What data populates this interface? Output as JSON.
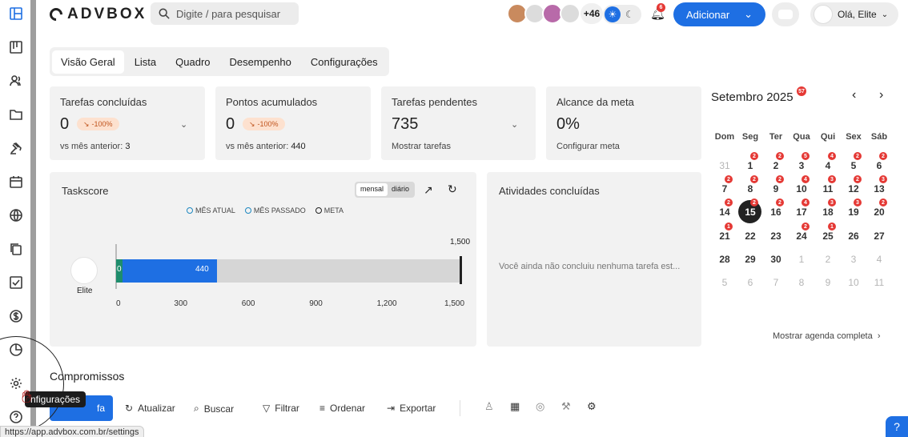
{
  "header": {
    "logo_text": "ADVBOX",
    "search_placeholder": "Digite / para pesquisar",
    "avatars_more": "+46",
    "notifications_count": "6",
    "add_label": "Adicionar",
    "user_greeting": "Olá, Elite"
  },
  "tabs": [
    "Visão Geral",
    "Lista",
    "Quadro",
    "Desempenho",
    "Configurações"
  ],
  "cards": [
    {
      "title": "Tarefas concluídas",
      "value": "0",
      "pill": "-100%",
      "foot_label": "vs mês anterior:",
      "foot_value": "3"
    },
    {
      "title": "Pontos acumulados",
      "value": "0",
      "pill": "-100%",
      "foot_label": "vs mês anterior:",
      "foot_value": "440"
    },
    {
      "title": "Tarefas pendentes",
      "value": "735",
      "foot_label": "Mostrar tarefas"
    },
    {
      "title": "Alcance da meta",
      "value": "0%",
      "foot_label": "Configurar meta"
    }
  ],
  "taskscore": {
    "title": "Taskscore",
    "toggle": [
      "mensal",
      "diário"
    ],
    "legend": [
      "MÊS ATUAL",
      "MÊS PASSADO",
      "META"
    ],
    "user_label": "Elite",
    "goal_label": "1,500",
    "current_label": "0",
    "previous_label": "440",
    "ticks": [
      "0",
      "300",
      "600",
      "900",
      "1,200",
      "1,500"
    ]
  },
  "chart_data": {
    "type": "bar",
    "categories": [
      "Elite"
    ],
    "series": [
      {
        "name": "MÊS ATUAL",
        "values": [
          0
        ]
      },
      {
        "name": "MÊS PASSADO",
        "values": [
          440
        ]
      },
      {
        "name": "META",
        "values": [
          1500
        ]
      }
    ],
    "xlim": [
      0,
      1500
    ],
    "xticks": [
      0,
      300,
      600,
      900,
      1200,
      1500
    ],
    "colors": {
      "current": "#1e8d6c",
      "previous": "#1e6fe3",
      "goal": "#222222"
    }
  },
  "activities": {
    "title": "Atividades concluídas",
    "empty": "Você ainda não concluiu nenhuma tarefa est..."
  },
  "calendar": {
    "title": "Setembro 2025",
    "title_badge": "57",
    "weekdays": [
      "Dom",
      "Seg",
      "Ter",
      "Qua",
      "Qui",
      "Sex",
      "Sáb"
    ],
    "weeks": [
      [
        {
          "d": "31",
          "m": true
        },
        {
          "d": "1",
          "n": "2"
        },
        {
          "d": "2",
          "n": "2"
        },
        {
          "d": "3",
          "n": "5"
        },
        {
          "d": "4",
          "n": "4"
        },
        {
          "d": "5",
          "n": "2"
        },
        {
          "d": "6",
          "n": "2"
        }
      ],
      [
        {
          "d": "7",
          "n": "2"
        },
        {
          "d": "8",
          "n": "2"
        },
        {
          "d": "9",
          "n": "2"
        },
        {
          "d": "10",
          "n": "4"
        },
        {
          "d": "11",
          "n": "3"
        },
        {
          "d": "12",
          "n": "2"
        },
        {
          "d": "13",
          "n": "3"
        }
      ],
      [
        {
          "d": "14",
          "n": "2"
        },
        {
          "d": "15",
          "n": "2",
          "today": true
        },
        {
          "d": "16",
          "n": "2"
        },
        {
          "d": "17",
          "n": "4"
        },
        {
          "d": "18",
          "n": "3"
        },
        {
          "d": "19",
          "n": "3"
        },
        {
          "d": "20",
          "n": "2"
        }
      ],
      [
        {
          "d": "21",
          "n": "1"
        },
        {
          "d": "22"
        },
        {
          "d": "23"
        },
        {
          "d": "24",
          "n": "2"
        },
        {
          "d": "25",
          "n": "1"
        },
        {
          "d": "26"
        },
        {
          "d": "27"
        }
      ],
      [
        {
          "d": "28"
        },
        {
          "d": "29"
        },
        {
          "d": "30"
        },
        {
          "d": "1",
          "m": true
        },
        {
          "d": "2",
          "m": true
        },
        {
          "d": "3",
          "m": true
        },
        {
          "d": "4",
          "m": true
        }
      ],
      [
        {
          "d": "5",
          "m": true
        },
        {
          "d": "6",
          "m": true
        },
        {
          "d": "7",
          "m": true
        },
        {
          "d": "8",
          "m": true
        },
        {
          "d": "9",
          "m": true
        },
        {
          "d": "10",
          "m": true
        },
        {
          "d": "11",
          "m": true
        }
      ]
    ],
    "show_all": "Mostrar agenda completa"
  },
  "compromissos": {
    "title": "Compromissos",
    "new_label": "fa",
    "actions": [
      "Atualizar",
      "Buscar",
      "Filtrar",
      "Ordenar",
      "Exportar"
    ]
  },
  "tooltip": "nfigurações",
  "status_url": "https://app.advbox.com.br/settings",
  "icons": [
    "layout-icon",
    "board-icon",
    "users-icon",
    "folder-icon",
    "gavel-icon",
    "calendar-icon",
    "globe-icon",
    "copy-icon",
    "checkbox-icon",
    "dollar-icon",
    "pie-icon",
    "gear-icon",
    "help-icon"
  ]
}
